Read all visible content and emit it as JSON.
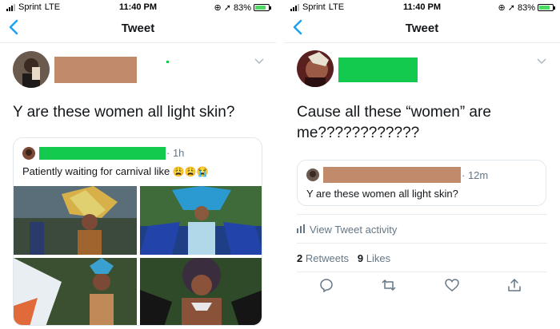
{
  "left": {
    "status": {
      "carrier": "Sprint",
      "network": "LTE",
      "time": "11:40 PM",
      "battery": "83%"
    },
    "nav": {
      "title": "Tweet"
    },
    "tweet_text": "Y are these women all light skin?",
    "quote": {
      "time": "· 1h",
      "text": "Patiently waiting for carnival like",
      "emoji": "😩😩😭"
    }
  },
  "right": {
    "status": {
      "carrier": "Sprint",
      "network": "LTE",
      "time": "11:40 PM",
      "battery": "83%"
    },
    "nav": {
      "title": "Tweet"
    },
    "tweet_text_line1": "Cause all these “women” are",
    "tweet_text_line2": "me????????????",
    "quote": {
      "time": "· 12m",
      "text": "Y are these women all light skin?"
    },
    "activity_label": "View Tweet activity",
    "retweets_count": "2",
    "retweets_label": "Retweets",
    "likes_count": "9",
    "likes_label": "Likes"
  },
  "colors": {
    "accent": "#1da1f2",
    "redaction": "#c18a6a",
    "green_redaction": "#13c94e",
    "battery_fill": "#4cd964"
  },
  "icons": [
    "back-arrow-icon",
    "location-icon",
    "alarm-icon",
    "battery-icon",
    "chevron-down-icon",
    "bar-chart-icon",
    "reply-icon",
    "retweet-icon",
    "like-icon",
    "share-icon"
  ]
}
